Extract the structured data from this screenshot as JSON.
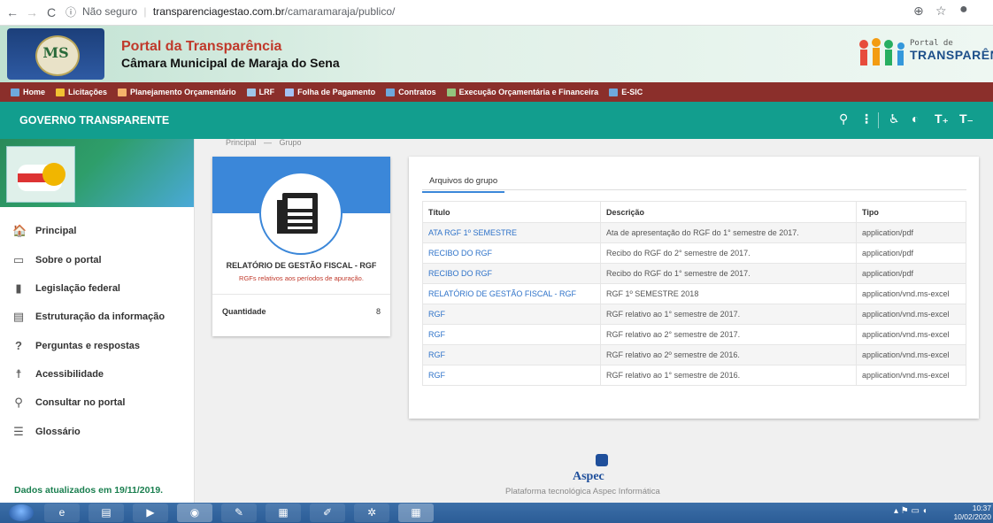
{
  "browser": {
    "url_security": "Não seguro",
    "url_host": "transparenciagestao.com.br",
    "url_path": "/camaramaraja/publico/"
  },
  "header": {
    "title": "Portal da Transparência",
    "subtitle": "Câmara Municipal de Maraja do Sena",
    "brand_small": "Portal de",
    "brand_big": "TRANSPARÊNCIA",
    "crest_letters": "MS"
  },
  "menu": [
    {
      "label": "Home",
      "icon_color": "#6fa8dc"
    },
    {
      "label": "Licitações",
      "icon_color": "#f1c232"
    },
    {
      "label": "Planejamento Orçamentário",
      "icon_color": "#f6b26b"
    },
    {
      "label": "LRF",
      "icon_color": "#9fc5e8"
    },
    {
      "label": "Folha de Pagamento",
      "icon_color": "#a4c2f4"
    },
    {
      "label": "Contratos",
      "icon_color": "#6fa8dc"
    },
    {
      "label": "Execução Orçamentária e Financeira",
      "icon_color": "#93c47d"
    },
    {
      "label": "E-SIC",
      "icon_color": "#6fa8dc"
    }
  ],
  "topbar": {
    "title": "GOVERNO TRANSPARENTE",
    "color": "#129e8e"
  },
  "sidebar": {
    "items": [
      {
        "label": "Principal",
        "icon": "home-icon"
      },
      {
        "label": "Sobre o portal",
        "icon": "folder-icon"
      },
      {
        "label": "Legislação federal",
        "icon": "document-icon"
      },
      {
        "label": "Estruturação da informação",
        "icon": "structure-icon"
      },
      {
        "label": "Perguntas e respostas",
        "icon": "help-icon"
      },
      {
        "label": "Acessibilidade",
        "icon": "accessibility-icon"
      },
      {
        "label": "Consultar no portal",
        "icon": "search-icon"
      },
      {
        "label": "Glossário",
        "icon": "list-icon"
      }
    ],
    "updated": "Dados atualizados em 19/11/2019."
  },
  "breadcrumb": {
    "home": "Principal",
    "current": "Grupo"
  },
  "group": {
    "title": "RELATÓRIO DE GESTÃO FISCAL - RGF",
    "subtitle": "RGFs relativos aos períodos de apuração.",
    "quantity_label": "Quantidade",
    "quantity_value": "8"
  },
  "files": {
    "tab": "Arquivos do grupo",
    "columns": [
      "Título",
      "Descrição",
      "Tipo"
    ],
    "rows": [
      {
        "title": "ATA RGF 1º SEMESTRE",
        "description": "Ata de apresentação do RGF do 1° semestre de 2017.",
        "type": "application/pdf"
      },
      {
        "title": "RECIBO DO RGF",
        "description": "Recibo do RGF do 2° semestre de 2017.",
        "type": "application/pdf"
      },
      {
        "title": "RECIBO DO RGF",
        "description": "Recibo do RGF do 1° semestre de 2017.",
        "type": "application/pdf"
      },
      {
        "title": "RELATÓRIO DE GESTÃO FISCAL - RGF",
        "description": "RGF 1º SEMESTRE 2018",
        "type": "application/vnd.ms-excel"
      },
      {
        "title": "RGF",
        "description": "RGF relativo ao 1° semestre de 2017.",
        "type": "application/vnd.ms-excel"
      },
      {
        "title": "RGF",
        "description": "RGF relativo ao 2° semestre de 2017.",
        "type": "application/vnd.ms-excel"
      },
      {
        "title": "RGF",
        "description": "RGF relativo ao 2º semestre de 2016.",
        "type": "application/vnd.ms-excel"
      },
      {
        "title": "RGF",
        "description": "RGF relativo ao 1° semestre de 2016.",
        "type": "application/vnd.ms-excel"
      }
    ]
  },
  "footer": {
    "brand": "Aspec",
    "text": "Plataforma tecnológica Aspec Informática"
  },
  "taskbar": {
    "time": "10:37",
    "date": "10/02/2020"
  }
}
